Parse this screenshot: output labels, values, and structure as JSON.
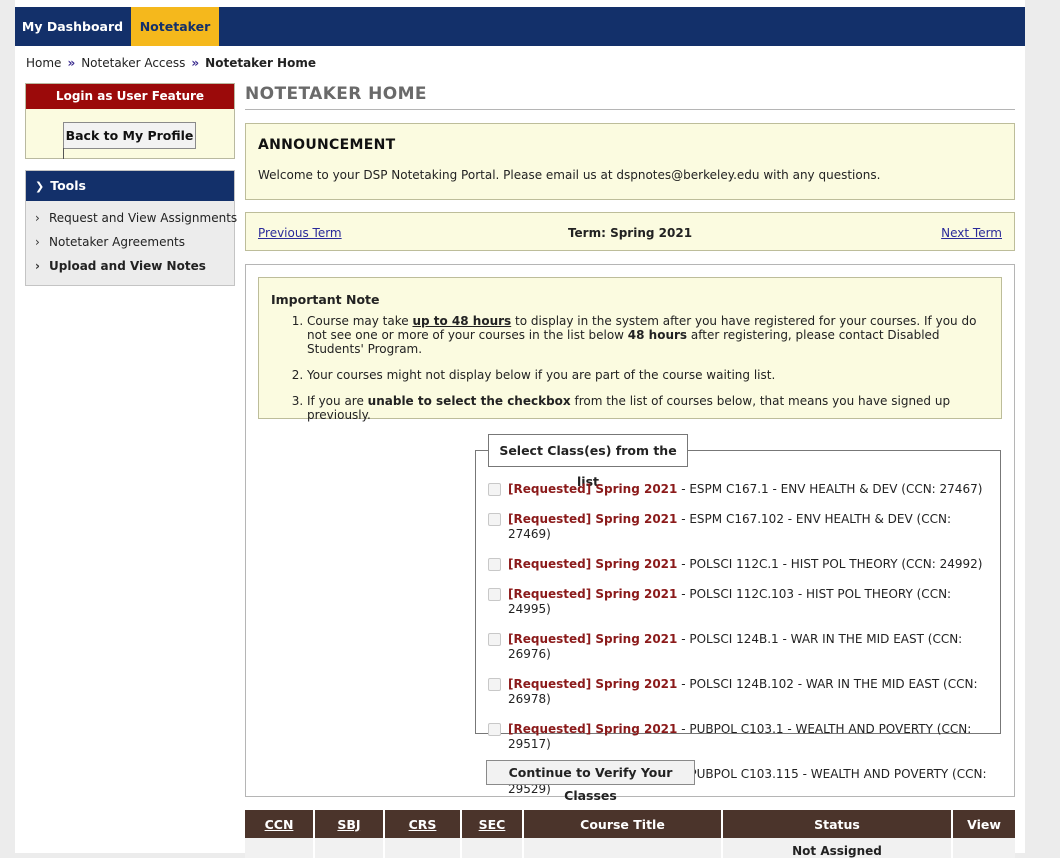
{
  "nav": {
    "dashboard": "My Dashboard",
    "notetaker": "Notetaker"
  },
  "breadcrumb": [
    "Home",
    "Notetaker Access",
    "Notetaker Home"
  ],
  "login_box": {
    "header": "Login as User Feature",
    "button": "Back to My Profile"
  },
  "tools": {
    "header": "Tools",
    "items": [
      {
        "label": "Request and View Assignments"
      },
      {
        "label": "Notetaker Agreements"
      },
      {
        "label": "Upload and View Notes"
      }
    ]
  },
  "page_title": "NOTETAKER HOME",
  "announcement": {
    "title": "ANNOUNCEMENT",
    "text": "Welcome to your DSP Notetaking Portal. Please email us at dspnotes@berkeley.edu with any questions."
  },
  "term": {
    "previous": "Previous Term",
    "current": "Term: Spring 2021",
    "next": "Next Term"
  },
  "important_note": {
    "title": "Important Note",
    "item1": {
      "a": "Course may take ",
      "b": "up to 48 hours",
      "c": " to display in the system after you have registered for your courses. If you do not see one or more of your courses in the list below ",
      "d": "48 hours",
      "e": " after registering, please contact Disabled Students' Program."
    },
    "item2": "Your courses might not display below if you are part of the course waiting list.",
    "item3": {
      "a": "If you are ",
      "b": "unable to select the checkbox",
      "c": " from the list of courses below, that means you have signed up previously."
    }
  },
  "class_select": {
    "legend": "Select Class(es) from the list",
    "tag": "[Requested] Spring 2021",
    "classes": [
      " - ESPM C167.1 - ENV HEALTH & DEV (CCN: 27467)",
      " - ESPM C167.102 - ENV HEALTH & DEV (CCN: 27469)",
      " - POLSCI 112C.1 - HIST POL THEORY (CCN: 24992)",
      " - POLSCI 112C.103 - HIST POL THEORY (CCN: 24995)",
      " - POLSCI 124B.1 - WAR IN THE MID EAST (CCN: 26976)",
      " - POLSCI 124B.102 - WAR IN THE MID EAST (CCN: 26978)",
      " - PUBPOL C103.1 - WEALTH AND POVERTY (CCN: 29517)",
      " - PUBPOL C103.115 - WEALTH AND POVERTY (CCN: 29529)"
    ],
    "button": "Continue to Verify Your Classes"
  },
  "table": {
    "headers": [
      "CCN",
      "SBJ",
      "CRS",
      "SEC",
      "Course Title",
      "Status",
      "View"
    ],
    "first_row_status": "Not Assigned"
  },
  "colors": {
    "navy": "#13306a",
    "gold": "#f5b81c",
    "dark_red": "#9b0a0a",
    "brown": "#4b342b",
    "cream": "#fbfbe0"
  }
}
